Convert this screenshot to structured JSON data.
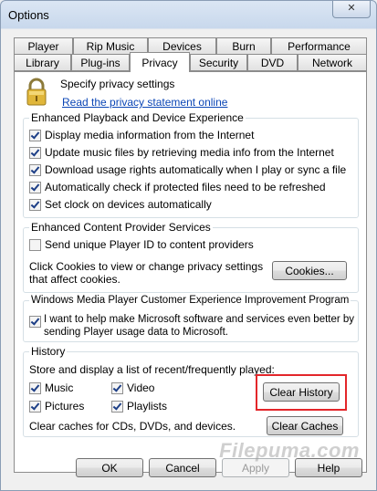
{
  "window": {
    "title": "Options",
    "close_label": "✕"
  },
  "tabs_row1": [
    "Player",
    "Rip Music",
    "Devices",
    "Burn",
    "Performance"
  ],
  "tabs_row2": [
    "Library",
    "Plug-ins",
    "Privacy",
    "Security",
    "DVD",
    "Network"
  ],
  "header": {
    "specify_text": "Specify privacy settings",
    "link_text": "Read the privacy statement online"
  },
  "playback": {
    "legend": "Enhanced Playback and Device Experience",
    "items": [
      "Display media information from the Internet",
      "Update music files by retrieving media info from the Internet",
      "Download usage rights automatically when I play or sync a file",
      "Automatically check if protected files need to be refreshed",
      "Set clock on devices automatically"
    ]
  },
  "content_provider": {
    "legend": "Enhanced Content Provider Services",
    "send_id": "Send unique Player ID to content providers",
    "cookies_text_1": "Click Cookies to view or change privacy settings",
    "cookies_text_2": "that affect cookies.",
    "cookies_button": "Cookies..."
  },
  "ceip": {
    "legend": "Windows Media Player Customer Experience Improvement Program",
    "text_1": "I want to help make Microsoft software and services even better by",
    "text_2": "sending Player usage data to Microsoft."
  },
  "history": {
    "legend": "History",
    "store_text": "Store and display a list of recent/frequently played:",
    "music": "Music",
    "video": "Video",
    "pictures": "Pictures",
    "playlists": "Playlists",
    "clear_history": "Clear History",
    "clear_caches_text": "Clear caches for CDs, DVDs, and devices.",
    "clear_caches": "Clear Caches"
  },
  "footer": {
    "ok": "OK",
    "cancel": "Cancel",
    "apply": "Apply",
    "help": "Help"
  },
  "watermark": "Filepuma.com",
  "colors": {
    "highlight": "#e3262a",
    "link": "#0b46b6"
  }
}
